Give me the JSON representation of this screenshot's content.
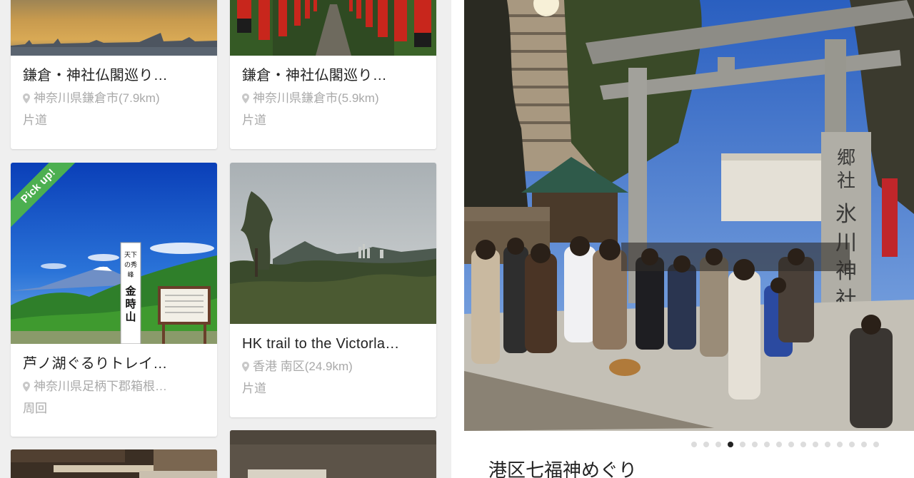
{
  "cards": [
    {
      "title": "鎌倉・神社仏閣巡り…",
      "location": "神奈川県鎌倉市(7.9km)",
      "type": "片道",
      "pickup": ""
    },
    {
      "title": "鎌倉・神社仏閣巡り…",
      "location": "神奈川県鎌倉市(5.9km)",
      "type": "片道",
      "pickup": ""
    },
    {
      "title": "芦ノ湖ぐるりトレイ…",
      "location": "神奈川県足柄下郡箱根…",
      "type": "周回",
      "pickup": "Pick up!"
    },
    {
      "title": "HK trail to the Victorla…",
      "location": "香港 南区(24.9km)",
      "type": "片道",
      "pickup": ""
    }
  ],
  "photo_text": {
    "monument": "天下の秀峰 金時山",
    "shrine_pillar": "郷社 氷川神社"
  },
  "detail": {
    "title": "港区七福神めぐり",
    "carousel_total": 16,
    "carousel_active": 4
  },
  "colors": {
    "pickup_ribbon": "#4caf50",
    "meta_text": "#a9a9a9",
    "grid_background": "#efefef",
    "dot_active": "#222222",
    "dot_inactive": "#dcdcdc"
  }
}
